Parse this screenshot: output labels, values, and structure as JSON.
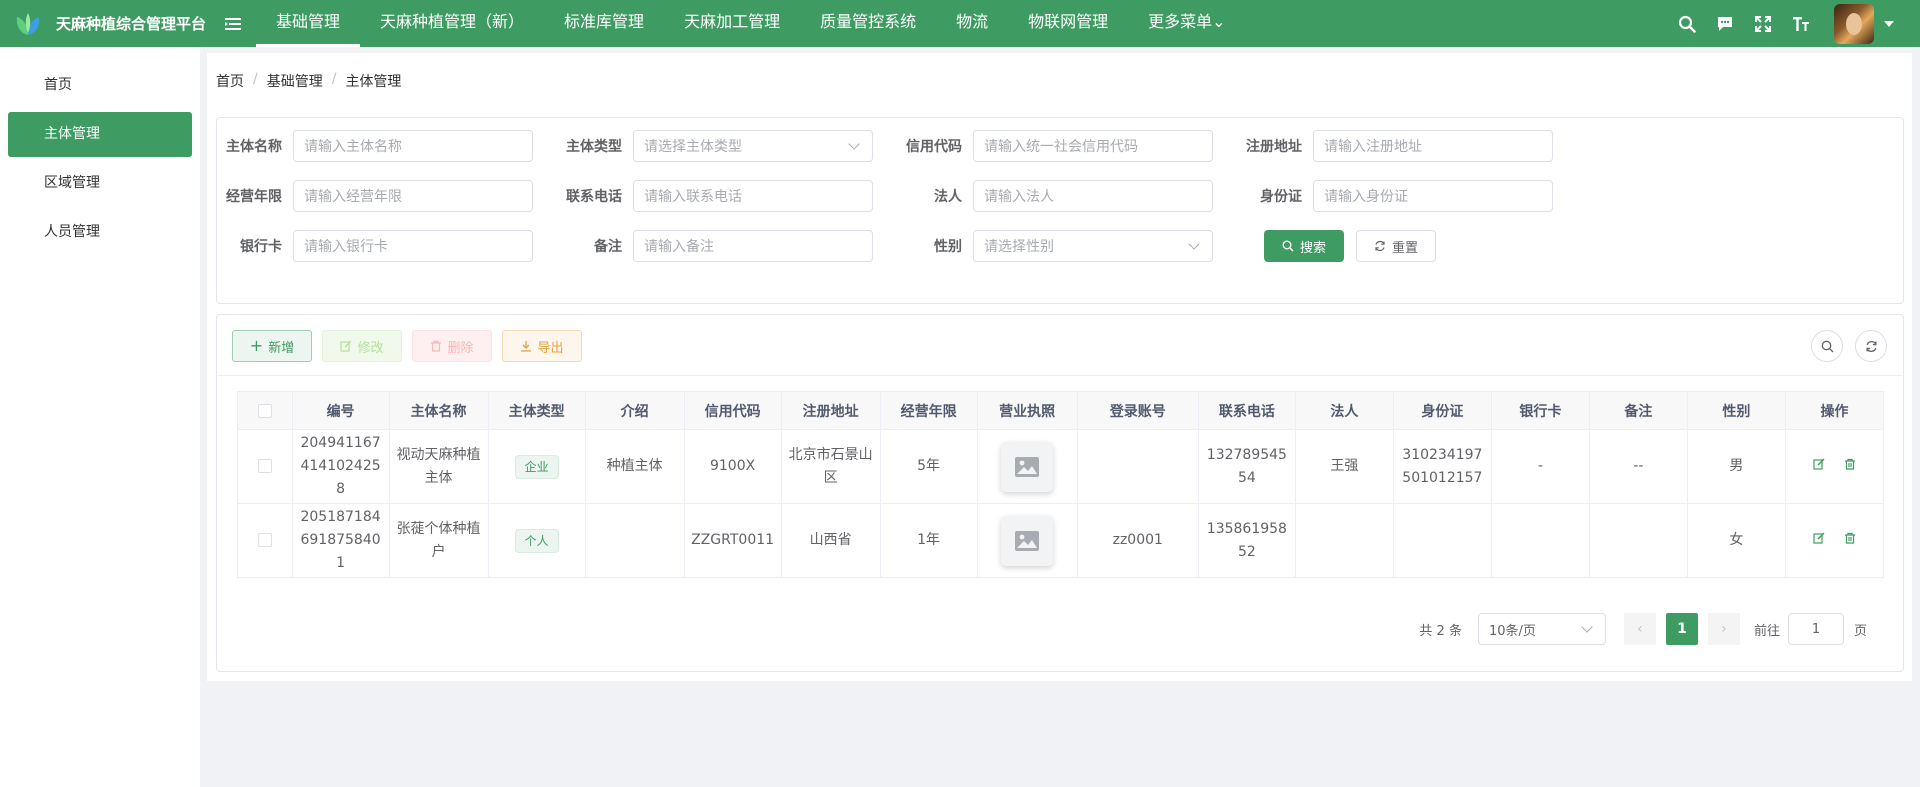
{
  "app": {
    "title": "天麻种植综合管理平台"
  },
  "topnav": [
    {
      "label": "基础管理",
      "active": true
    },
    {
      "label": "天麻种植管理（新）"
    },
    {
      "label": "标准库管理"
    },
    {
      "label": "天麻加工管理"
    },
    {
      "label": "质量管控系统"
    },
    {
      "label": "物流"
    },
    {
      "label": "物联网管理"
    },
    {
      "label": "更多菜单⌄"
    }
  ],
  "top_icons": [
    "search-icon",
    "message-icon",
    "fullscreen-icon",
    "font-size-icon"
  ],
  "sidebar": {
    "items": [
      {
        "label": "首页"
      },
      {
        "label": "主体管理",
        "active": true
      },
      {
        "label": "区域管理"
      },
      {
        "label": "人员管理"
      }
    ]
  },
  "breadcrumb": [
    "首页",
    "基础管理",
    "主体管理"
  ],
  "search": {
    "fields": [
      {
        "label": "主体名称",
        "placeholder": "请输入主体名称"
      },
      {
        "label": "主体类型",
        "placeholder": "请选择主体类型",
        "select": true
      },
      {
        "label": "信用代码",
        "placeholder": "请输入统一社会信用代码"
      },
      {
        "label": "注册地址",
        "placeholder": "请输入注册地址"
      },
      {
        "label": "经营年限",
        "placeholder": "请输入经营年限"
      },
      {
        "label": "联系电话",
        "placeholder": "请输入联系电话"
      },
      {
        "label": "法人",
        "placeholder": "请输入法人"
      },
      {
        "label": "身份证",
        "placeholder": "请输入身份证"
      },
      {
        "label": "银行卡",
        "placeholder": "请输入银行卡"
      },
      {
        "label": "备注",
        "placeholder": "请输入备注"
      },
      {
        "label": "性别",
        "placeholder": "请选择性别",
        "select": true
      }
    ],
    "search_label": "搜索",
    "reset_label": "重置"
  },
  "toolbar": {
    "add": "新增",
    "edit": "修改",
    "delete": "删除",
    "export": "导出"
  },
  "table": {
    "columns": [
      "编号",
      "主体名称",
      "主体类型",
      "介绍",
      "信用代码",
      "注册地址",
      "经营年限",
      "营业执照",
      "登录账号",
      "联系电话",
      "法人",
      "身份证",
      "银行卡",
      "备注",
      "性别",
      "操作"
    ],
    "rows": [
      {
        "id": "2049411674141024258",
        "name": "视动天麻种植主体",
        "type": "企业",
        "intro": "种植主体",
        "credit": "9100X",
        "address": "北京市石景山区",
        "years": "5年",
        "account": "",
        "phone": "13278954554",
        "legal": "王强",
        "idcard": "310234197501012157",
        "bank": "-",
        "remark": "--",
        "gender": "男"
      },
      {
        "id": "2051871846918758401",
        "name": "张蓰个体种植户",
        "type": "个人",
        "intro": "",
        "credit": "ZZGRT0011",
        "address": "山西省",
        "years": "1年",
        "account": "zz0001",
        "phone": "13586195852",
        "legal": "",
        "idcard": "",
        "bank": "",
        "remark": "",
        "gender": "女"
      }
    ]
  },
  "pagination": {
    "total": "共 2 条",
    "page_size": "10条/页",
    "current": "1",
    "goto_label": "前往",
    "goto_value": "1",
    "page_suffix": "页"
  },
  "colors": {
    "primary": "#3e9c62"
  }
}
